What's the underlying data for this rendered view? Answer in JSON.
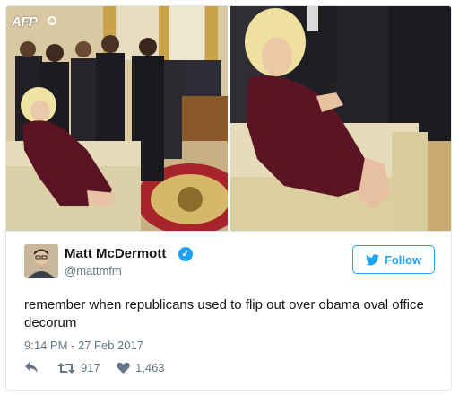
{
  "photos": {
    "agency_mark": "AFP"
  },
  "user": {
    "display_name": "Matt McDermott",
    "handle": "@mattmfm",
    "verified": true
  },
  "follow_button": {
    "label": "Follow"
  },
  "tweet": {
    "text": "remember when republicans used to flip out over obama oval office decorum",
    "timestamp": "9:14 PM - 27 Feb 2017"
  },
  "stats": {
    "retweets": "917",
    "likes": "1,463"
  },
  "colors": {
    "accent": "#1da1f2",
    "muted": "#657786",
    "text": "#14171a"
  },
  "icons": [
    "reply-icon",
    "retweet-icon",
    "heart-icon",
    "twitter-bird-icon",
    "verified-badge-icon"
  ]
}
